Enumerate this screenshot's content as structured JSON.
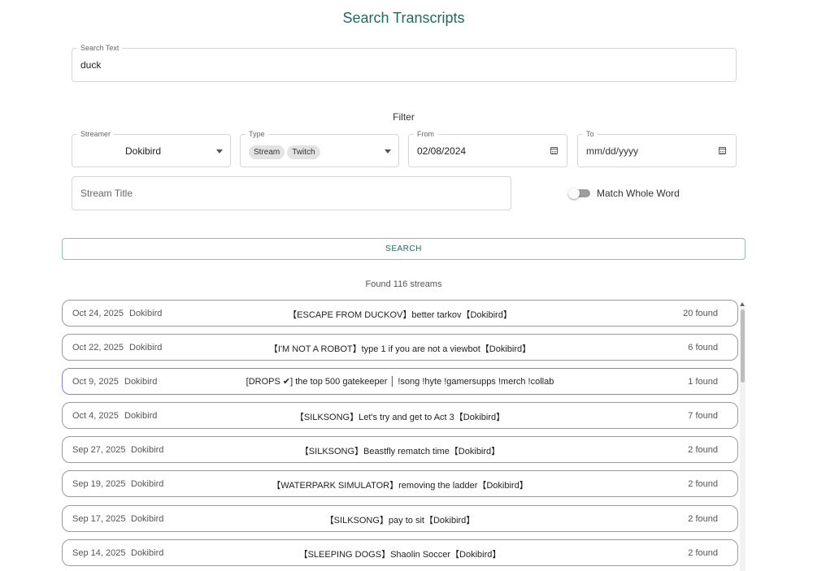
{
  "page": {
    "title": "Search Transcripts",
    "filter_heading": "Filter",
    "found_text": "Found 116 streams"
  },
  "search": {
    "label": "Search Text",
    "value": "duck"
  },
  "filters": {
    "streamer": {
      "label": "Streamer",
      "value": "Dokibird"
    },
    "type": {
      "label": "Type",
      "chips": [
        "Stream",
        "Twitch"
      ]
    },
    "from": {
      "label": "From",
      "value": "02/08/2024"
    },
    "to": {
      "label": "To",
      "value": "mm/dd/yyyy"
    },
    "stream_title": {
      "placeholder": "Stream Title"
    },
    "match_whole_word": {
      "label": "Match Whole Word",
      "checked": false
    }
  },
  "search_button": {
    "label": "SEARCH"
  },
  "results": [
    {
      "date": "Oct 24, 2025",
      "streamer": "Dokibird",
      "title": "【ESCAPE FROM DUCKOV】better tarkov【Dokibird】",
      "count": "20 found"
    },
    {
      "date": "Oct 22, 2025",
      "streamer": "Dokibird",
      "title": "【I'M NOT A ROBOT】type 1 if you are not a viewbot【Dokibird】",
      "count": "6 found"
    },
    {
      "date": "Oct 9, 2025",
      "streamer": "Dokibird",
      "title": "[DROPS ✔] the top 500 gatekeeper │ !song !hyte !gamersupps !merch !collab",
      "count": "1 found"
    },
    {
      "date": "Oct 4, 2025",
      "streamer": "Dokibird",
      "title": "【SILKSONG】Let's try and get to Act 3【Dokibird】",
      "count": "7 found"
    },
    {
      "date": "Sep 27, 2025",
      "streamer": "Dokibird",
      "title": "【SILKSONG】Beastfly rematch time【Dokibird】",
      "count": "2 found"
    },
    {
      "date": "Sep 19, 2025",
      "streamer": "Dokibird",
      "title": "【WATERPARK SIMULATOR】removing the ladder【Dokibird】",
      "count": "2 found"
    },
    {
      "date": "Sep 17, 2025",
      "streamer": "Dokibird",
      "title": "【SILKSONG】pay to sit【Dokibird】",
      "count": "2 found"
    },
    {
      "date": "Sep 14, 2025",
      "streamer": "Dokibird",
      "title": "【SLEEPING DOGS】Shaolin Soccer【Dokibird】",
      "count": "2 found"
    }
  ]
}
